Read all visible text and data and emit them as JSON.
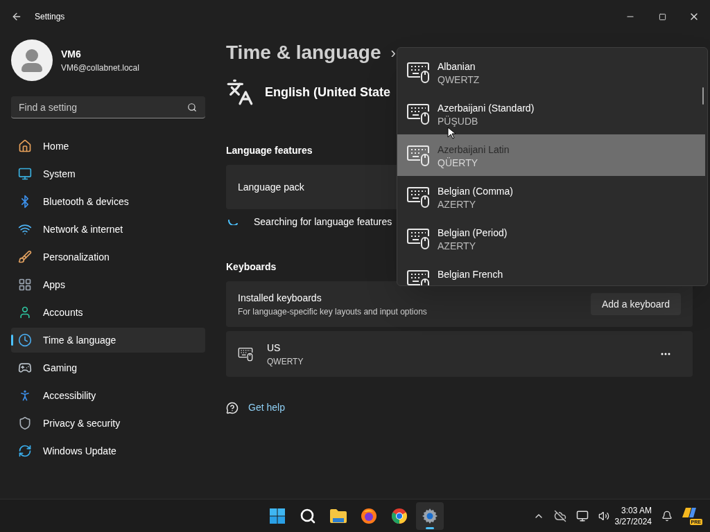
{
  "window": {
    "title": "Settings"
  },
  "user": {
    "name": "VM6",
    "email": "VM6@collabnet.local"
  },
  "search": {
    "placeholder": "Find a setting"
  },
  "nav": [
    {
      "label": "Home",
      "kind": "home",
      "selected": false
    },
    {
      "label": "System",
      "kind": "system",
      "selected": false
    },
    {
      "label": "Bluetooth & devices",
      "kind": "bluetooth",
      "selected": false
    },
    {
      "label": "Network & internet",
      "kind": "network",
      "selected": false
    },
    {
      "label": "Personalization",
      "kind": "brush",
      "selected": false
    },
    {
      "label": "Apps",
      "kind": "apps",
      "selected": false
    },
    {
      "label": "Accounts",
      "kind": "accounts",
      "selected": false
    },
    {
      "label": "Time & language",
      "kind": "time",
      "selected": true
    },
    {
      "label": "Gaming",
      "kind": "gaming",
      "selected": false
    },
    {
      "label": "Accessibility",
      "kind": "accessibility",
      "selected": false
    },
    {
      "label": "Privacy & security",
      "kind": "privacy",
      "selected": false
    },
    {
      "label": "Windows Update",
      "kind": "update",
      "selected": false
    }
  ],
  "breadcrumb": {
    "parent": "Time & language",
    "separator": "›"
  },
  "language": {
    "name": "English (United State"
  },
  "language_features": {
    "heading": "Language features",
    "language_pack": "Language pack",
    "status": "Searching for language features"
  },
  "keyboards": {
    "heading": "Keyboards",
    "installed": {
      "title": "Installed keyboards",
      "subtitle": "For language-specific key layouts and input options",
      "button": "Add a keyboard"
    },
    "items": [
      {
        "name": "US",
        "layout": "QWERTY"
      }
    ]
  },
  "get_help": "Get help",
  "dropdown": {
    "items": [
      {
        "name": "Albanian",
        "layout": "QWERTZ",
        "selected": false
      },
      {
        "name": "Azerbaijani (Standard)",
        "layout": "PÜŞUDB",
        "selected": false
      },
      {
        "name": "Azerbaijani Latin",
        "layout": "QÜERTY",
        "selected": true
      },
      {
        "name": "Belgian (Comma)",
        "layout": "AZERTY",
        "selected": false
      },
      {
        "name": "Belgian (Period)",
        "layout": "AZERTY",
        "selected": false
      },
      {
        "name": "Belgian French",
        "selected": false
      }
    ]
  },
  "taskbar": {
    "apps": [
      {
        "kind": "start",
        "selected": false
      },
      {
        "kind": "search",
        "selected": false
      },
      {
        "kind": "files",
        "selected": false
      },
      {
        "kind": "firefox",
        "selected": false
      },
      {
        "kind": "chrome",
        "selected": false
      },
      {
        "kind": "settings",
        "selected": true
      }
    ],
    "time": "3:03 AM",
    "date": "3/27/2024",
    "badge": "PRE"
  }
}
